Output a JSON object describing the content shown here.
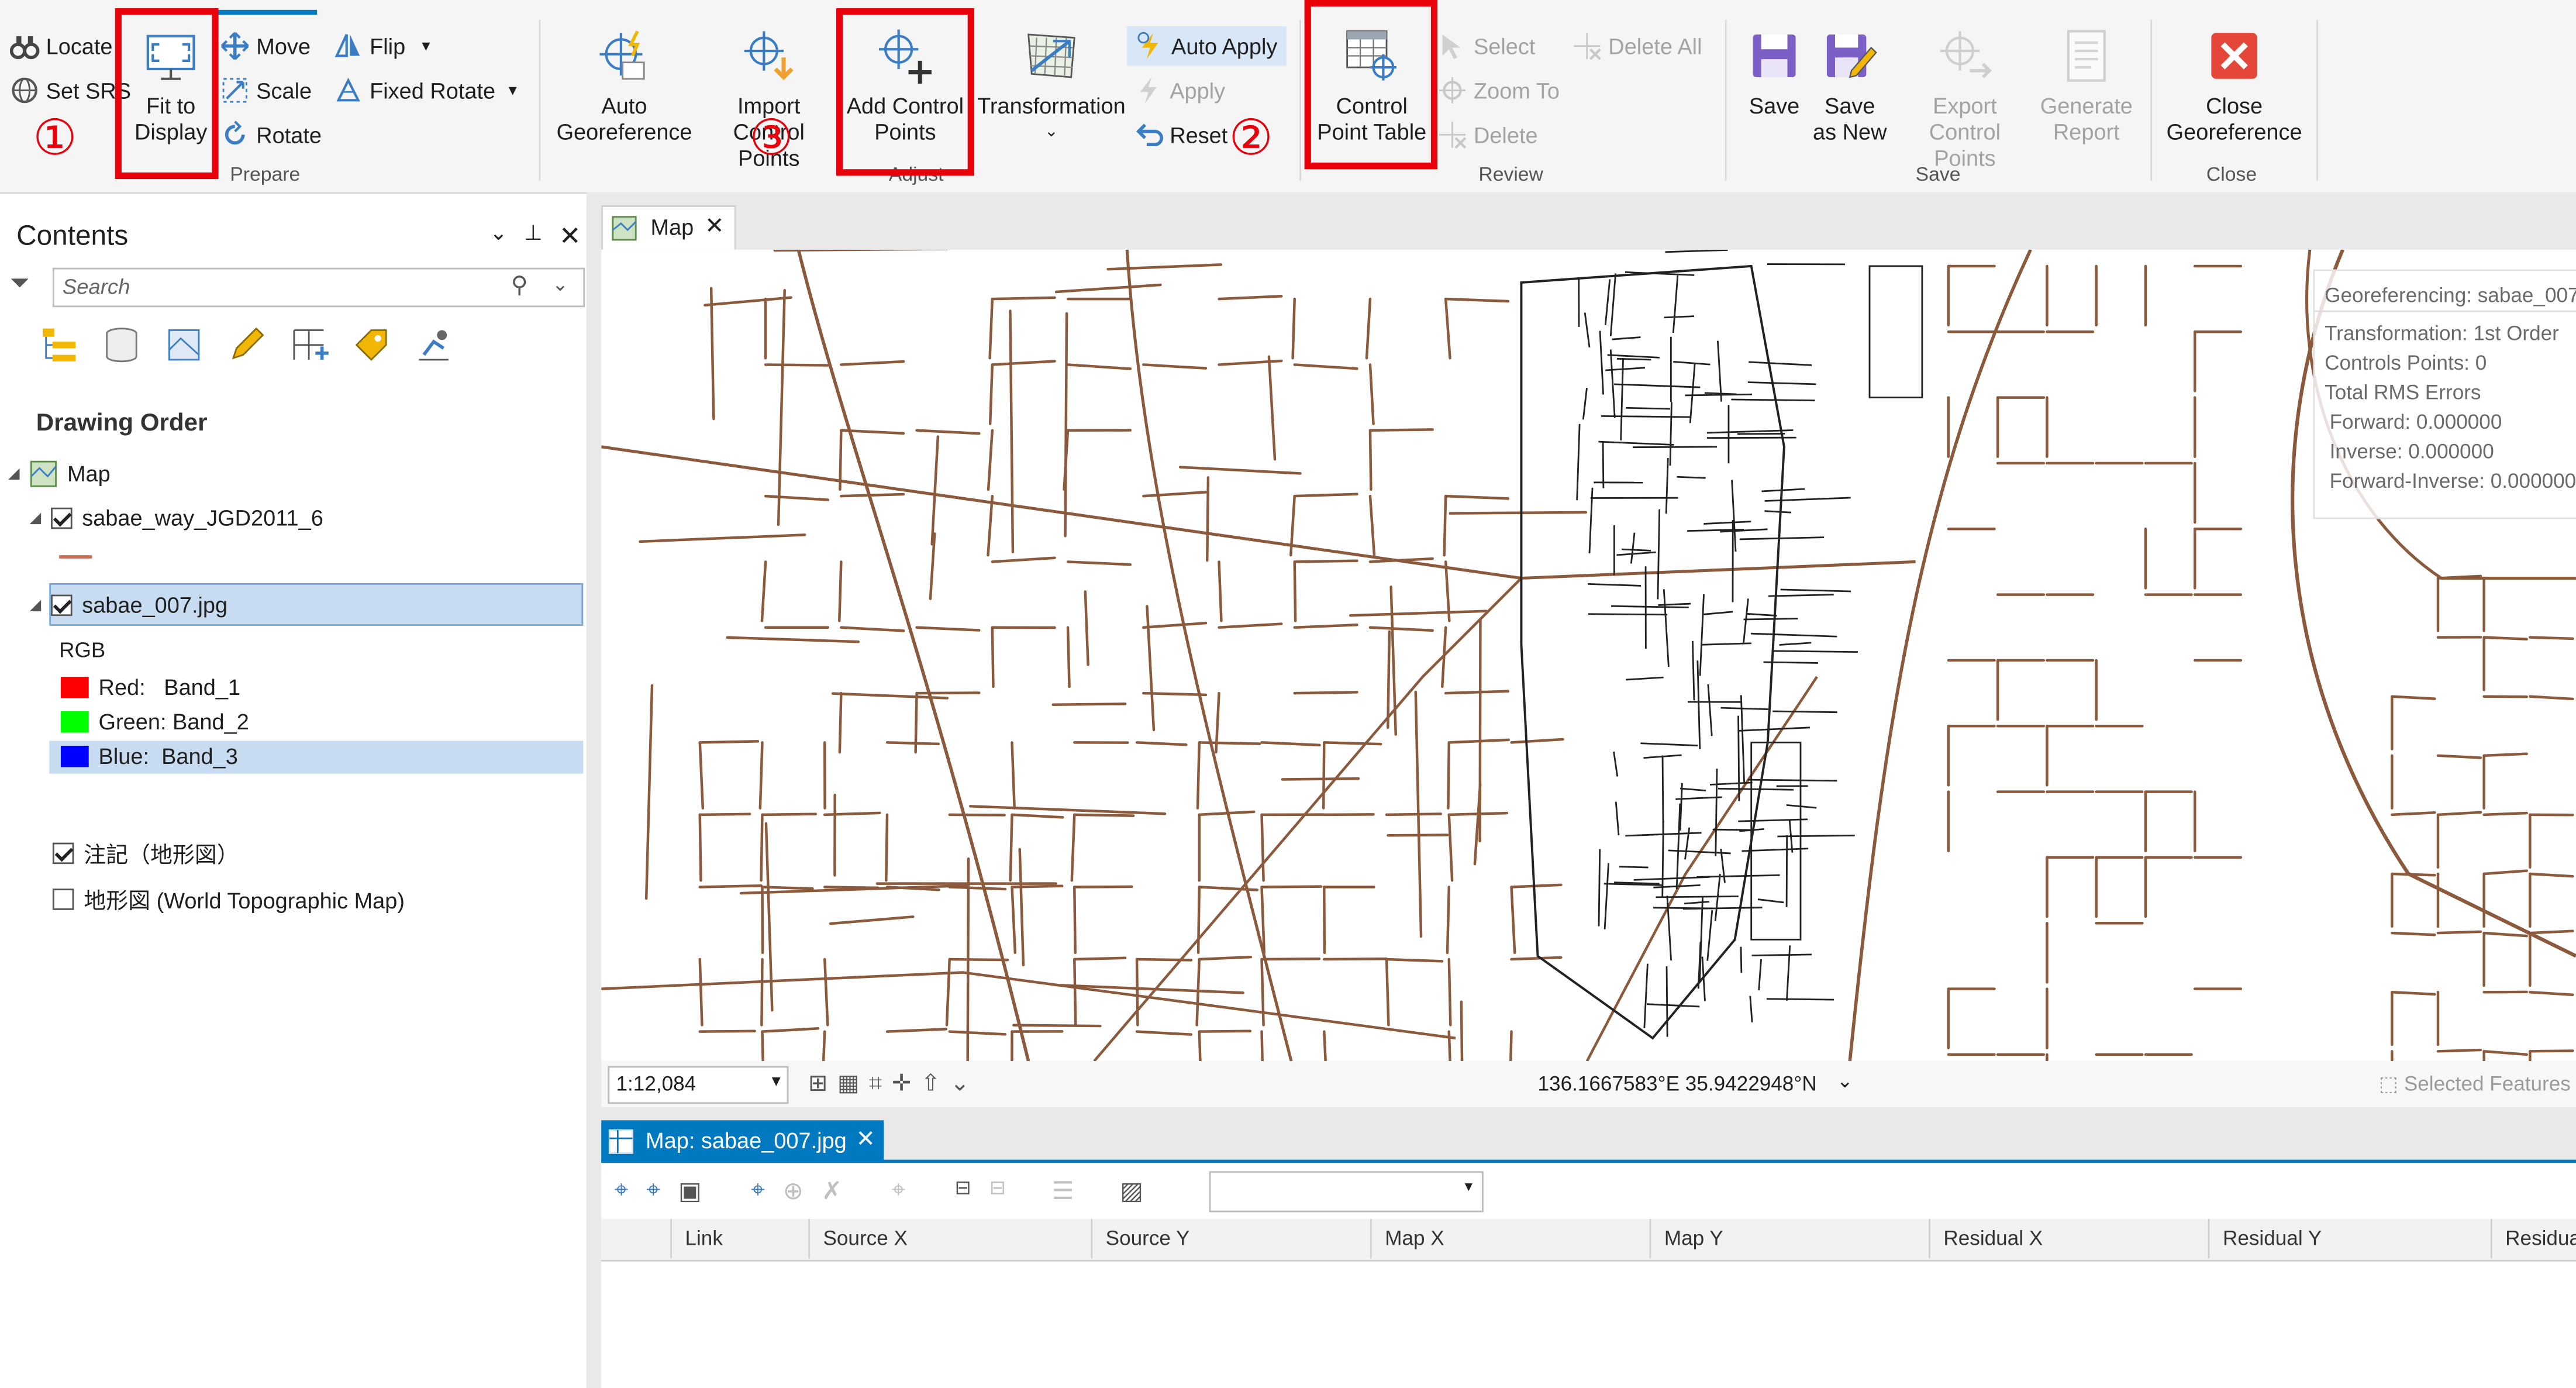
{
  "ribbon": {
    "prepare": {
      "locate": "Locate",
      "set_srs": "Set SRS",
      "fit_to_display_l1": "Fit to",
      "fit_to_display_l2": "Display",
      "move": "Move",
      "scale": "Scale",
      "rotate": "Rotate",
      "flip": "Flip",
      "fixed_rotate": "Fixed Rotate",
      "group_label": "Prepare"
    },
    "adjust": {
      "auto_georef_l1": "Auto",
      "auto_georef_l2": "Georeference",
      "import_cp_l1": "Import",
      "import_cp_l2": "Control Points",
      "add_cp_l1": "Add Control",
      "add_cp_l2": "Points",
      "transformation": "Transformation",
      "auto_apply": "Auto Apply",
      "apply": "Apply",
      "reset": "Reset",
      "group_label": "Adjust"
    },
    "review": {
      "cp_table_l1": "Control",
      "cp_table_l2": "Point Table",
      "select": "Select",
      "zoom_to": "Zoom To",
      "delete": "Delete",
      "delete_all": "Delete All",
      "group_label": "Review"
    },
    "save": {
      "save": "Save",
      "save_as_new_l1": "Save",
      "save_as_new_l2": "as New",
      "export_cp_l1": "Export",
      "export_cp_l2": "Control Points",
      "generate_report_l1": "Generate",
      "generate_report_l2": "Report",
      "group_label": "Save"
    },
    "close": {
      "close_l1": "Close",
      "close_l2": "Georeference",
      "group_label": "Close"
    }
  },
  "annotations": {
    "n1": "①",
    "n2": "②",
    "n3": "③"
  },
  "contents": {
    "title": "Contents",
    "search_placeholder": "Search",
    "drawing_order": "Drawing Order",
    "map_node": "Map",
    "layer1": "sabae_way_JGD2011_6",
    "layer2": "sabae_007.jpg",
    "rgb": "RGB",
    "red": "Red:   Band_1",
    "green": "Green: Band_2",
    "blue": "Blue:  Band_3",
    "layer3": "注記（地形図）",
    "layer4": "地形図 (World Topographic Map)"
  },
  "map_view": {
    "tab": "Map",
    "info_title": "Georeferencing: sabae_007",
    "info_transformation": "Transformation: 1st Order",
    "info_cp": "Controls Points: 0",
    "info_rms": "Total RMS Errors",
    "info_forward": "Forward: 0.000000",
    "info_inverse": "Inverse: 0.000000",
    "info_fi": "Forward-Inverse: 0.000000",
    "scale": "1:12,084",
    "coords": "136.1667583°E 35.9422948°N",
    "selected_features": "Selected Features"
  },
  "cp_table": {
    "tab": "Map: sabae_007.jpg",
    "columns": [
      "Link",
      "Source X",
      "Source Y",
      "Map X",
      "Map Y",
      "Residual X",
      "Residual Y",
      "Residual"
    ]
  },
  "colors": {
    "road": "#8b5a3c",
    "annotation_red": "#e8000b",
    "accent_blue": "#0079c1"
  }
}
